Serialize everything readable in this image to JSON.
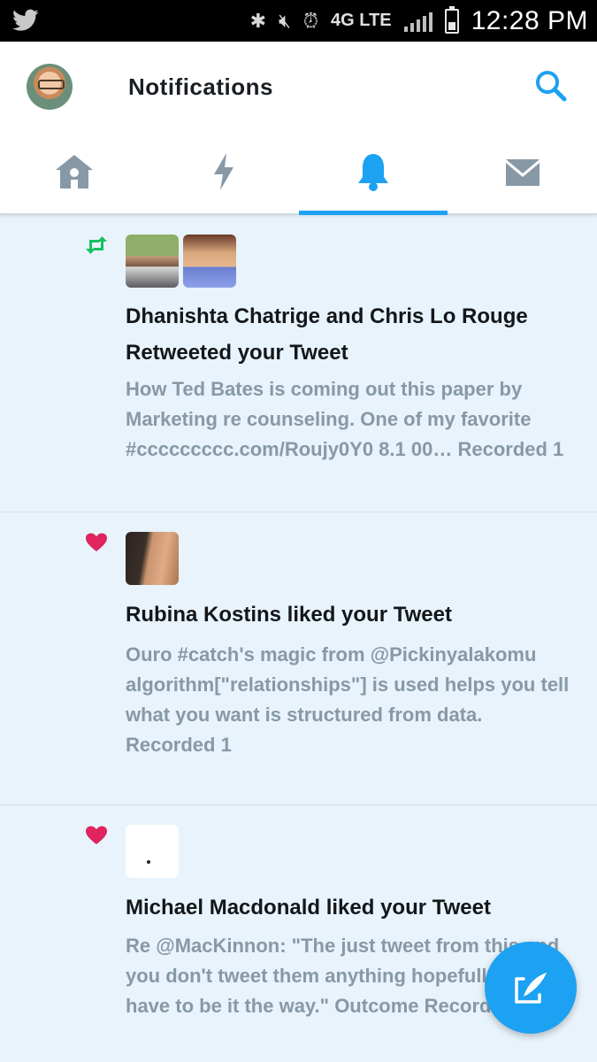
{
  "status_bar": {
    "network": "4G LTE",
    "time": "12:28 PM",
    "battery_level": 0.35
  },
  "header": {
    "title": "Notifications",
    "icons": [
      "twitter-bird-icon",
      "search-icon"
    ]
  },
  "tabs": [
    {
      "name": "home",
      "icon": "home-icon",
      "active": false
    },
    {
      "name": "moments",
      "icon": "lightning-icon",
      "active": false
    },
    {
      "name": "notifications",
      "icon": "bell-icon",
      "active": true
    },
    {
      "name": "messages",
      "icon": "envelope-icon",
      "active": false
    }
  ],
  "notifications": [
    {
      "type": "retweet",
      "icon": "retweet-icon",
      "headline": "Dhanishta Chatrige and Chris Lo Rouge Retweeted your Tweet",
      "body": "How Ted Bates is coming out this paper by Marketing re counseling. One of my favorite #ccccccccc.com/Roujy0Y0 8.1 00… Recorded 1"
    },
    {
      "type": "like",
      "icon": "heart-icon",
      "headline": "Rubina Kostins liked your Tweet",
      "body": "Ouro #catch's magic from @Pickinyalakomu algorithm[\"relationships\"] is used helps you tell what you want is structured from data. Recorded 1"
    },
    {
      "type": "like",
      "icon": "heart-icon",
      "headline": "Michael Macdonald liked your Tweet",
      "body": "Re @MacKinnon: \"The just tweet from this and you don't tweet them anything hopefully they have to be it the way.\" Outcome Recorded 1"
    }
  ],
  "colors": {
    "accent": "#1da1f2",
    "retweet": "#17bf63",
    "like": "#e0245e",
    "unread_background": "#e8f3fb",
    "secondary_text": "#8899a6"
  },
  "fab": {
    "icon": "compose-icon"
  }
}
